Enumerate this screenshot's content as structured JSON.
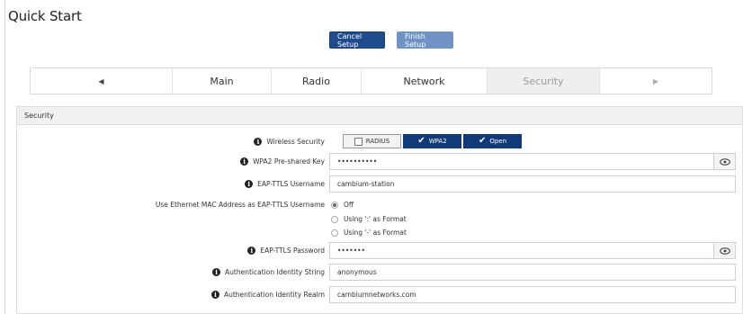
{
  "page": {
    "title": "Quick Start"
  },
  "toolbar": {
    "cancel_label": "Cancel Setup",
    "finish_label": "Finish Setup"
  },
  "tabs": {
    "prev_arrow": "◀",
    "next_arrow": "▶",
    "items": [
      {
        "label": "Main"
      },
      {
        "label": "Radio"
      },
      {
        "label": "Network"
      },
      {
        "label": "Security"
      }
    ],
    "active": "Security"
  },
  "panel": {
    "title": "Security"
  },
  "fields": {
    "wireless_security": {
      "label": "Wireless Security",
      "options": [
        {
          "label": "RADIUS",
          "checked": false
        },
        {
          "label": "WPA2",
          "checked": true
        },
        {
          "label": "Open",
          "checked": true
        }
      ]
    },
    "wpa2_key": {
      "label": "WPA2 Pre-shared Key",
      "value": "••••••••••"
    },
    "eap_username": {
      "label": "EAP-TTLS Username",
      "value": "cambium-station"
    },
    "mac_as_username": {
      "label": "Use Ethernet MAC Address as EAP-TTLS Username",
      "options": [
        {
          "label": "Off",
          "selected": true
        },
        {
          "label": "Using ':' as Format",
          "selected": false
        },
        {
          "label": "Using '-' as Format",
          "selected": false
        }
      ]
    },
    "eap_password": {
      "label": "EAP-TTLS Password",
      "value": "•••••••"
    },
    "auth_identity_string": {
      "label": "Authentication Identity String",
      "value": "anonymous"
    },
    "auth_identity_realm": {
      "label": "Authentication Identity Realm",
      "value": "cambiumnetworks.com"
    }
  },
  "icons": {
    "info": "info-icon",
    "eye": "eye-icon",
    "check": "check-icon"
  },
  "colors": {
    "primary": "#1f4c8f",
    "secondary": "#6f93c4",
    "selected_segment": "#123a78"
  }
}
